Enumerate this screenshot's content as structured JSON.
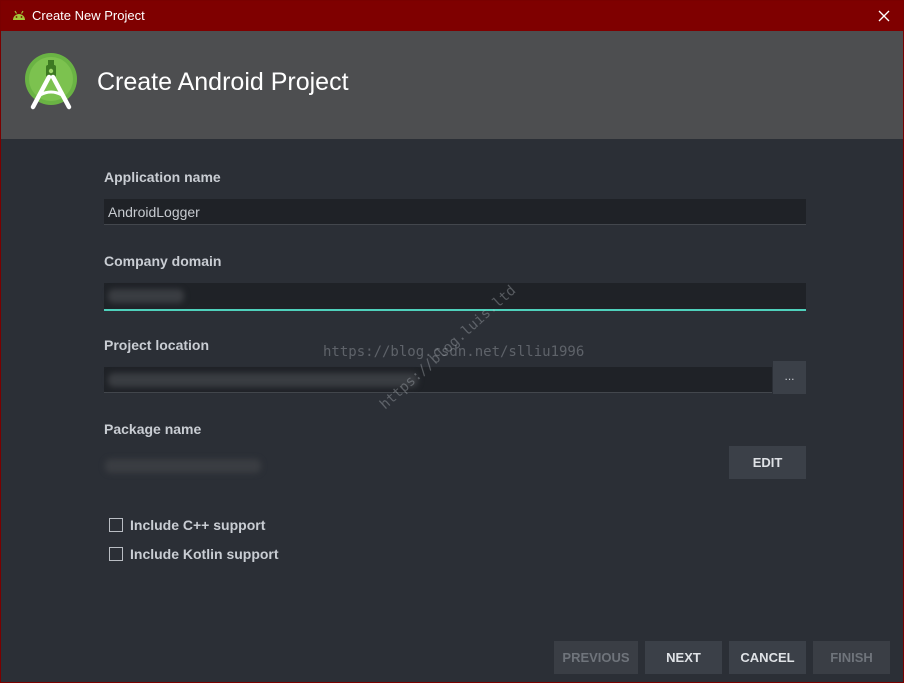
{
  "window": {
    "title": "Create New Project",
    "close_icon": "close-icon",
    "app_icon": "android-icon"
  },
  "header": {
    "title": "Create Android Project",
    "logo_icon": "android-studio-logo"
  },
  "form": {
    "application_name": {
      "label": "Application name",
      "value": "AndroidLogger"
    },
    "company_domain": {
      "label": "Company domain",
      "value": ""
    },
    "project_location": {
      "label": "Project location",
      "value": "",
      "browse_label": "..."
    },
    "package_name": {
      "label": "Package name",
      "value": "",
      "edit_label": "EDIT"
    },
    "options": [
      {
        "label": "Include C++ support",
        "checked": false
      },
      {
        "label": "Include Kotlin support",
        "checked": false
      }
    ]
  },
  "footer": {
    "previous_label": "PREVIOUS",
    "next_label": "NEXT",
    "cancel_label": "CANCEL",
    "finish_label": "FINISH"
  },
  "watermark": {
    "horizontal": "https://blog.csdn.net/slliu1996",
    "diagonal": "https://blog.luis.ltd"
  },
  "colors": {
    "titlebar": "#7f0000",
    "header": "#4d4e50",
    "body": "#2b2f36",
    "focus_accent": "#4fd1bc"
  }
}
